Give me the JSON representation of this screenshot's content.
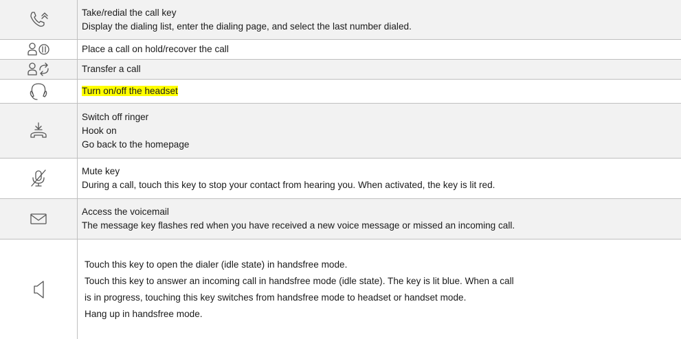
{
  "rows": [
    {
      "icon": "phone-redial-icon",
      "lines": [
        "Take/redial the call key",
        "Display the dialing list, enter the dialing page, and select the last number dialed."
      ]
    },
    {
      "icon": "hold-call-icon",
      "lines": [
        "Place a call on hold/recover the call"
      ]
    },
    {
      "icon": "transfer-call-icon",
      "lines": [
        "Transfer a call"
      ]
    },
    {
      "icon": "headset-icon",
      "lines": [
        "Turn on/off the headset"
      ],
      "highlight_color": "#ffff00"
    },
    {
      "icon": "hang-up-icon",
      "lines": [
        "Switch off ringer",
        "Hook on",
        "Go back to the homepage"
      ]
    },
    {
      "icon": "mute-microphone-icon",
      "lines": [
        "Mute key",
        "During a call, touch this key to stop your contact from hearing you. When activated, the key is lit red."
      ]
    },
    {
      "icon": "envelope-icon",
      "lines": [
        "Access the voicemail",
        "The message key flashes red when you have received a new voice message or missed an incoming call."
      ]
    },
    {
      "icon": "speaker-icon",
      "lines": [
        "Touch this key to open the dialer (idle state) in handsfree mode.",
        "Touch this key to answer an incoming call in handsfree mode (idle state). The key is lit blue. When a call",
        "is in progress, touching this key switches from handsfree mode to headset or handset mode.",
        "Hang up in handsfree mode."
      ]
    }
  ],
  "colors": {
    "row_shade": "#f2f2f2",
    "border": "#bfbfbf",
    "highlight": "#ffff00",
    "icon_stroke": "#555555"
  }
}
